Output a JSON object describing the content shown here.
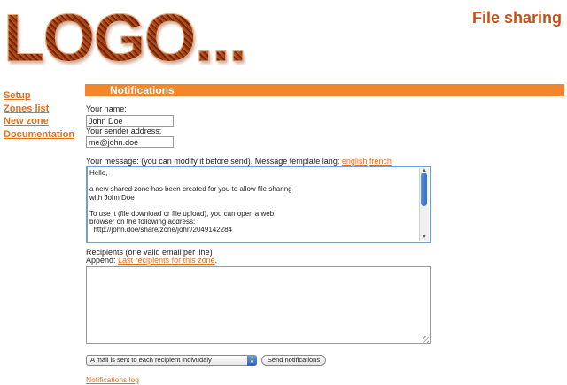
{
  "header": {
    "logo_text": "LOGO...",
    "app_title": "File sharing"
  },
  "sidebar": {
    "items": [
      {
        "label": "Setup"
      },
      {
        "label": "Zones list"
      },
      {
        "label": "New zone"
      },
      {
        "label": "Documentation"
      }
    ]
  },
  "section": {
    "title": "Notifications"
  },
  "form": {
    "name_label": "Your name:",
    "name_value": "John Doe",
    "sender_label": "Your sender address:",
    "sender_value": "me@john.doe",
    "message_label": "Your message: (you can modify it before send). Message template lang:",
    "lang_english": "english",
    "lang_french": "french",
    "message_text": "Hello,\n\na new shared zone has been created for you to allow file sharing\nwith John Doe\n\nTo use it (file download or file upload), you can open a web\nbrowser on the following address:\n  http://john.doe/share/zone/john/2049142284\n\nRegards",
    "recipients_label": "Recipients (one valid email per line)",
    "append_label": "Append:",
    "append_link": "Last recipients for this zone",
    "append_suffix": ".",
    "recipients_value": "",
    "send_mode_selected": "A mail is sent to each recipient indivudaly",
    "send_button": "Send notifications",
    "log_link": "Notifications log"
  },
  "colors": {
    "accent": "#f2862a",
    "link": "#e0701c",
    "title": "#c0521e"
  }
}
